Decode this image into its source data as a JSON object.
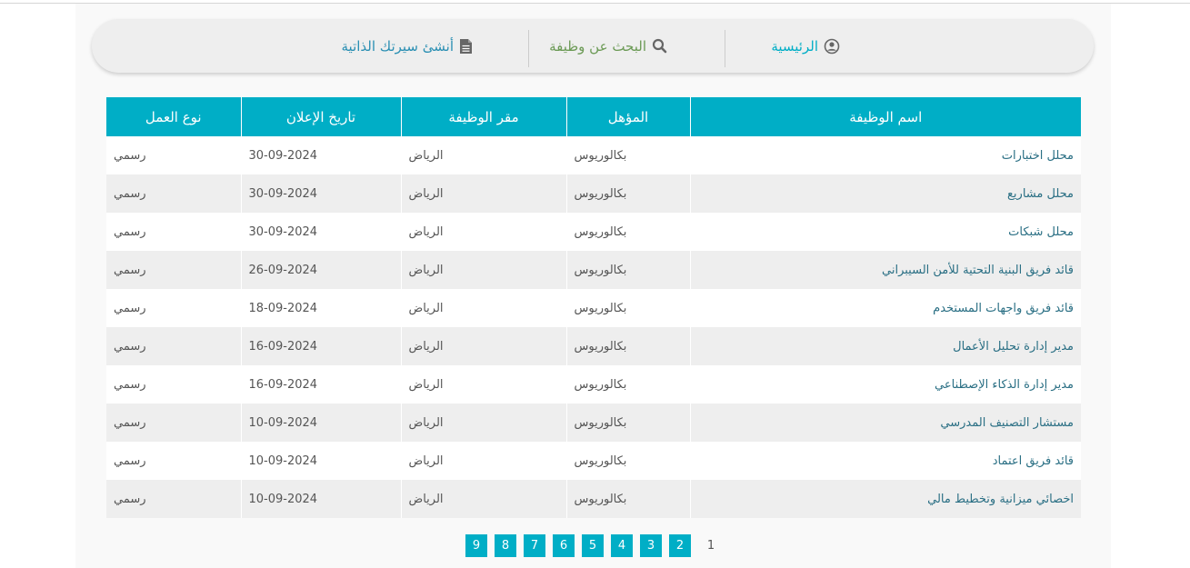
{
  "nav": {
    "home_label": "الرئيسية",
    "search_label": "البحث عن وظيفة",
    "cv_label": "أنشئ سيرتك الذاتية"
  },
  "table": {
    "headers": {
      "title": "اسم الوظيفة",
      "qualification": "المؤهل",
      "location": "مقر الوظيفة",
      "date": "تاريخ الإعلان",
      "type": "نوع العمل"
    },
    "rows": [
      {
        "title": "محلل اختبارات",
        "qualification": "بكالوريوس",
        "location": "الرياض",
        "date": "30-09-2024",
        "type": "رسمي"
      },
      {
        "title": "محلل مشاريع",
        "qualification": "بكالوريوس",
        "location": "الرياض",
        "date": "30-09-2024",
        "type": "رسمي"
      },
      {
        "title": "محلل شبكات",
        "qualification": "بكالوريوس",
        "location": "الرياض",
        "date": "30-09-2024",
        "type": "رسمي"
      },
      {
        "title": "قائد فريق البنية التحتية للأمن السيبراني",
        "qualification": "بكالوريوس",
        "location": "الرياض",
        "date": "26-09-2024",
        "type": "رسمي"
      },
      {
        "title": "قائد فريق واجهات المستخدم",
        "qualification": "بكالوريوس",
        "location": "الرياض",
        "date": "18-09-2024",
        "type": "رسمي"
      },
      {
        "title": "مدير إدارة تحليل الأعمال",
        "qualification": "بكالوريوس",
        "location": "الرياض",
        "date": "16-09-2024",
        "type": "رسمي"
      },
      {
        "title": "مدير إدارة الذكاء الإصطناعي",
        "qualification": "بكالوريوس",
        "location": "الرياض",
        "date": "16-09-2024",
        "type": "رسمي"
      },
      {
        "title": "مستشار التصنيف المدرسي",
        "qualification": "بكالوريوس",
        "location": "الرياض",
        "date": "10-09-2024",
        "type": "رسمي"
      },
      {
        "title": "قائد فريق اعتماد",
        "qualification": "بكالوريوس",
        "location": "الرياض",
        "date": "10-09-2024",
        "type": "رسمي"
      },
      {
        "title": "اخصائي ميزانية وتخطيط مالي",
        "qualification": "بكالوريوس",
        "location": "الرياض",
        "date": "10-09-2024",
        "type": "رسمي"
      }
    ]
  },
  "pagination": {
    "current": "1",
    "pages": [
      "2",
      "3",
      "4",
      "5",
      "6",
      "7",
      "8",
      "9"
    ]
  },
  "colors": {
    "accent": "#00aec6",
    "row_alt": "#eeeeee"
  }
}
